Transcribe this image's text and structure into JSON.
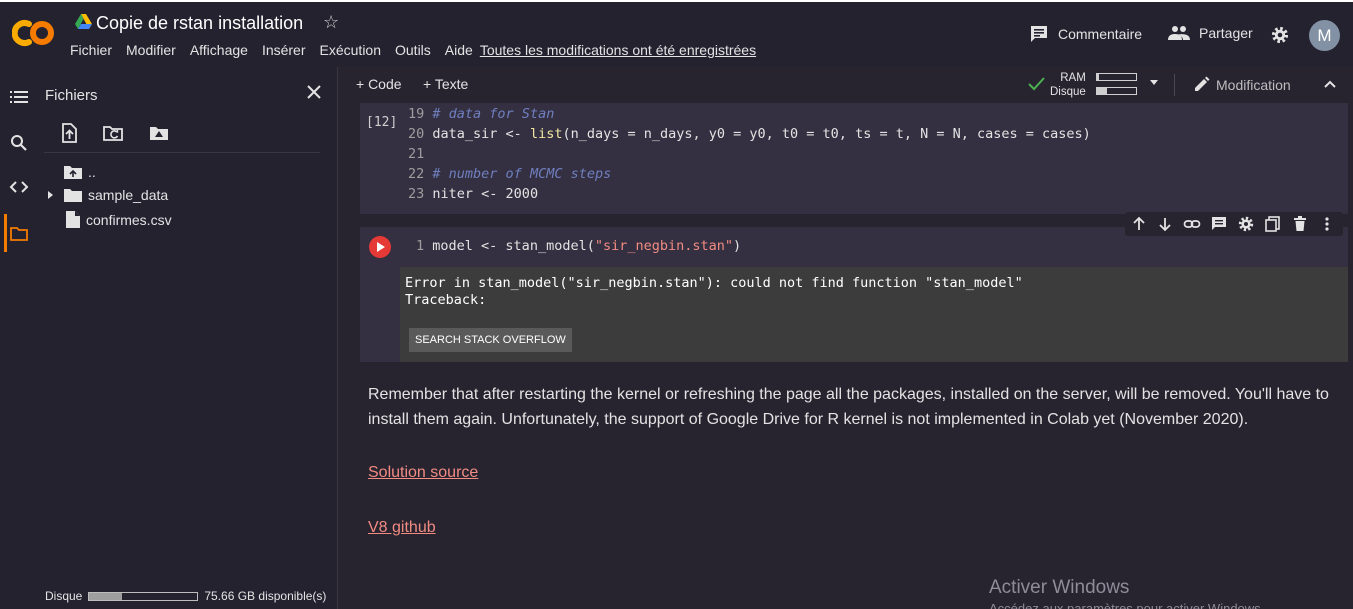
{
  "header": {
    "title": "Copie de rstan installation",
    "menu": [
      "Fichier",
      "Modifier",
      "Affichage",
      "Insérer",
      "Exécution",
      "Outils",
      "Aide"
    ],
    "saved_status": "Toutes les modifications ont été enregistrées",
    "comment_label": "Commentaire",
    "share_label": "Partager",
    "avatar_initial": "M"
  },
  "files": {
    "title": "Fichiers",
    "tree": [
      {
        "name": "..",
        "kind": "parent-folder"
      },
      {
        "name": "sample_data",
        "kind": "folder"
      },
      {
        "name": "confirmes.csv",
        "kind": "file"
      }
    ],
    "disk_label": "Disque",
    "disk_available": "75.66 GB disponible(s)",
    "disk_used_fraction": 0.3
  },
  "toolbar": {
    "add_code": "+ Code",
    "add_text": "+ Texte",
    "ram_label": "RAM",
    "disk_label": "Disque",
    "ram_used_fraction": 0.05,
    "disk_used_fraction": 0.25,
    "edit_mode": "Modification"
  },
  "cell1": {
    "exec_count": "[12]",
    "lines": [
      {
        "n": "19",
        "comment": "# data for Stan"
      },
      {
        "n": "20",
        "pre": "data_sir <- ",
        "fn": "list",
        "post": "(n_days = n_days, y0 = y0, t0 = t0, ts = t, N = N, cases = cases)"
      },
      {
        "n": "21"
      },
      {
        "n": "22",
        "comment": "# number of MCMC steps"
      },
      {
        "n": "23",
        "pre": "niter <- 2000"
      }
    ]
  },
  "cell2": {
    "line_no": "1",
    "code_pre": "model <- stan_model(",
    "code_str": "\"sir_negbin.stan\"",
    "code_post": ")",
    "output_lines": "Error in stan_model(\"sir_negbin.stan\"): could not find function \"stan_model\"\nTraceback:",
    "so_button": "SEARCH STACK OVERFLOW"
  },
  "text_cell": {
    "paragraph": "Remember that after restarting the kernel or refreshing the page all the packages, installed on the server, will be removed. You'll have to install them again. Unfortunately, the support of Google Drive for R kernel is not implemented in Colab yet (November 2020).",
    "link1": "Solution source",
    "link2": "V8 github"
  },
  "watermark": {
    "title": "Activer Windows",
    "subtitle": "Accédez aux paramètres pour activer Windows."
  },
  "colors": {
    "accent": "#f57c00",
    "link": "#f28b82",
    "run": "#e53935",
    "background": "#272430",
    "cell": "#343041"
  }
}
